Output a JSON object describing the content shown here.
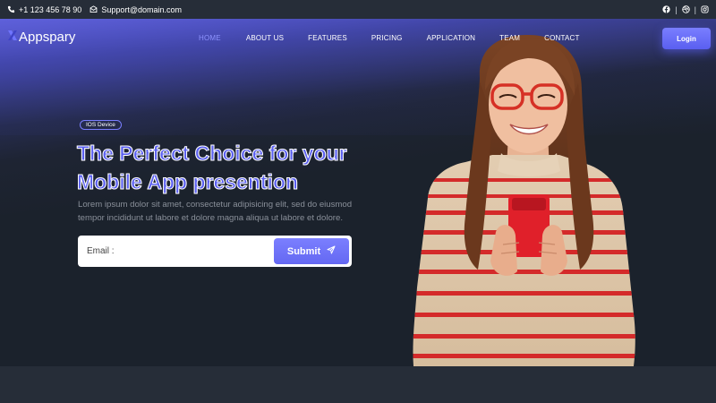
{
  "topbar": {
    "phone": "+1 123 456 78 90",
    "email": "Support@domain.com",
    "social_icons": [
      "facebook-icon",
      "dribbble-icon",
      "instagram-icon"
    ]
  },
  "brand": {
    "name": "Appspary",
    "accent": "#6f74ff"
  },
  "nav": {
    "items": [
      {
        "label": "HOME",
        "active": true
      },
      {
        "label": "ABOUT US",
        "active": false
      },
      {
        "label": "FEATURES",
        "active": false
      },
      {
        "label": "PRICING",
        "active": false
      },
      {
        "label": "APPLICATION",
        "active": false
      },
      {
        "label": "TEAM",
        "active": false
      },
      {
        "label": "CONTACT",
        "active": false
      }
    ],
    "login_label": "Login"
  },
  "hero": {
    "badge": "IOS Device",
    "title_line1": "The Perfect Choice for your",
    "title_line2": "Mobile App presention",
    "description": "Lorem ipsum dolor sit amet, consectetur adipisicing elit, sed do eiusmod tempor incididunt ut labore et dolore magna aliqua ut labore et dolore.",
    "email_label": "Email :",
    "submit_label": "Submit"
  }
}
